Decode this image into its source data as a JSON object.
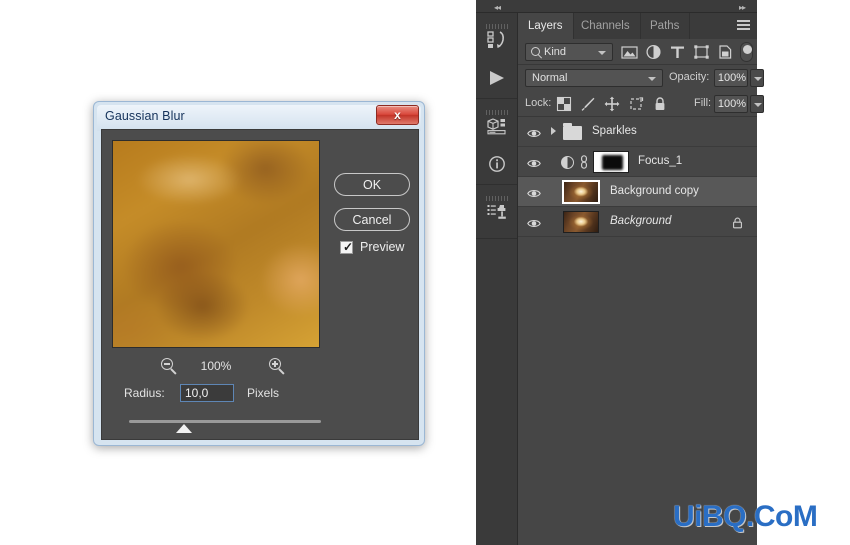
{
  "dialog": {
    "title": "Gaussian Blur",
    "close_label": "x",
    "ok_label": "OK",
    "cancel_label": "Cancel",
    "preview_label": "Preview",
    "preview_checked": true,
    "zoom_level": "100%",
    "zoom_out_icon": "magnifier-minus-icon",
    "zoom_in_icon": "magnifier-plus-icon",
    "radius_label": "Radius:",
    "radius_value": "10,0",
    "radius_units": "Pixels",
    "preview_thumbnail_name": "blurred-golden-image"
  },
  "panel": {
    "collapse_left_icon": "◂◂",
    "collapse_right_icon": "▸▸",
    "menu_icon": "hamburger-menu-icon",
    "rail_icons": [
      {
        "name": "history-icon"
      },
      {
        "name": "play-actions-icon"
      },
      {
        "name": "properties-3d-icon"
      },
      {
        "name": "info-icon"
      },
      {
        "name": "clone-source-icon"
      }
    ],
    "tabs": [
      {
        "label": "Layers",
        "active": true
      },
      {
        "label": "Channels",
        "active": false
      },
      {
        "label": "Paths",
        "active": false
      }
    ],
    "filter": {
      "kind_label": "Kind",
      "search_icon": "search-icon",
      "icons": [
        {
          "name": "filter-image-icon"
        },
        {
          "name": "filter-adjustment-icon"
        },
        {
          "name": "filter-type-icon"
        },
        {
          "name": "filter-shape-icon"
        },
        {
          "name": "filter-smart-object-icon"
        }
      ],
      "toggle_name": "filter-enable-toggle"
    },
    "blend": {
      "mode": "Normal",
      "opacity_label": "Opacity:",
      "opacity_value": "100%"
    },
    "lock": {
      "label": "Lock:",
      "icons": [
        {
          "name": "lock-transparent-pixels-icon"
        },
        {
          "name": "lock-image-pixels-icon"
        },
        {
          "name": "lock-position-icon"
        },
        {
          "name": "lock-artboard-nesting-icon"
        },
        {
          "name": "lock-all-icon"
        }
      ],
      "fill_label": "Fill:",
      "fill_value": "100%"
    },
    "layers": [
      {
        "name": "Sparkles",
        "type": "group",
        "visible": true,
        "selected": false,
        "italic": false,
        "locked": false
      },
      {
        "name": "Focus_1",
        "type": "adjustment",
        "visible": true,
        "selected": false,
        "italic": false,
        "locked": false
      },
      {
        "name": "Background copy",
        "type": "pixel",
        "visible": true,
        "selected": true,
        "italic": false,
        "locked": false
      },
      {
        "name": "Background",
        "type": "pixel",
        "visible": true,
        "selected": false,
        "italic": true,
        "locked": true
      }
    ]
  },
  "watermark": {
    "text": "UiBQ.CoM",
    "color": "#2a6ec4"
  }
}
